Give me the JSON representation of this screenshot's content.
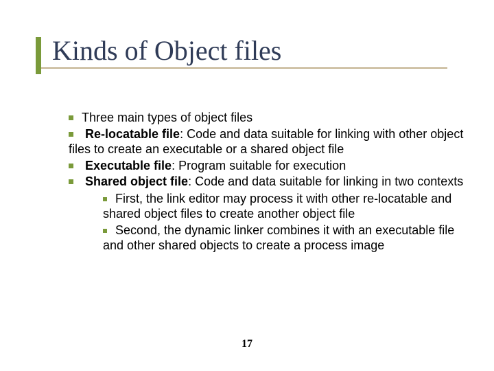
{
  "title": "Kinds of Object files",
  "bullets": {
    "b1": "Three main types of object files",
    "b2_bold": "Re-locatable file",
    "b2_rest": ": Code and data suitable for linking with other object files to create an executable or a shared object file",
    "b3_bold": "Executable file",
    "b3_rest": ": Program suitable for execution",
    "b4_bold": "Shared object file",
    "b4_rest": ": Code and data suitable for linking in two contexts",
    "sub1": "First, the link editor may process it with other re-locatable and shared object files to create another object file",
    "sub2": "Second, the dynamic linker combines it with an executable file and other shared objects to create a process image"
  },
  "page": "17"
}
